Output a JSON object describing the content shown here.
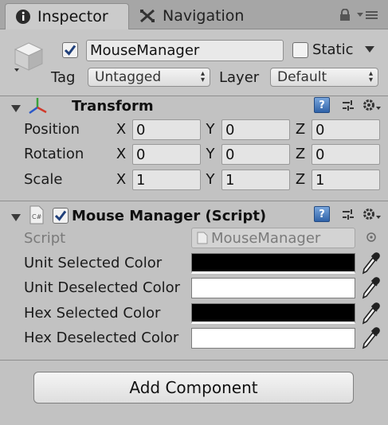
{
  "tabs": {
    "inspector_label": "Inspector",
    "navigation_label": "Navigation"
  },
  "header": {
    "active_checked": true,
    "object_name": "MouseManager",
    "static_label": "Static",
    "static_checked": false,
    "tag_label": "Tag",
    "tag_value": "Untagged",
    "layer_label": "Layer",
    "layer_value": "Default"
  },
  "transform": {
    "title": "Transform",
    "rows": [
      {
        "label": "Position",
        "x": "0",
        "y": "0",
        "z": "0"
      },
      {
        "label": "Rotation",
        "x": "0",
        "y": "0",
        "z": "0"
      },
      {
        "label": "Scale",
        "x": "1",
        "y": "1",
        "z": "1"
      }
    ],
    "axes": {
      "x": "X",
      "y": "Y",
      "z": "Z"
    }
  },
  "script_component": {
    "title": "Mouse Manager (Script)",
    "enabled": true,
    "icon_text": "C#",
    "script_label": "Script",
    "script_value": "MouseManager",
    "colors": [
      {
        "label": "Unit Selected Color",
        "color": "#000000"
      },
      {
        "label": "Unit Deselected Color",
        "color": "#ffffff"
      },
      {
        "label": "Hex Selected Color",
        "color": "#000000"
      },
      {
        "label": "Hex Deselected Color",
        "color": "#ffffff"
      }
    ]
  },
  "add_component_label": "Add Component",
  "icons": [
    "info-icon",
    "navigation-icon",
    "lock-icon",
    "menu-icon",
    "gameobject-cube-icon",
    "transform-axis-icon",
    "help-icon",
    "preset-icon",
    "gear-icon",
    "script-file-icon",
    "object-picker-icon",
    "eyedropper-icon",
    "foldout-arrow-icon"
  ]
}
